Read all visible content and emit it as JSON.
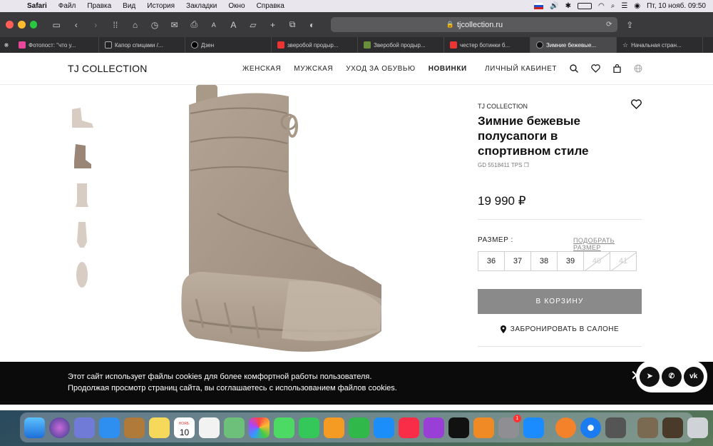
{
  "menubar": {
    "app": "Safari",
    "items": [
      "Файл",
      "Правка",
      "Вид",
      "История",
      "Закладки",
      "Окно",
      "Справка"
    ],
    "datetime": "Пт, 10 нояб.  09:50"
  },
  "browser": {
    "url": "tjcollection.ru",
    "tabs": [
      {
        "label": "Фотопост: \"что у...",
        "active": false
      },
      {
        "label": "Капор спицами /...",
        "active": false
      },
      {
        "label": "Дзен",
        "active": false
      },
      {
        "label": "зверобой продыр...",
        "active": false
      },
      {
        "label": "Зверобой продыр...",
        "active": false
      },
      {
        "label": "честер ботинки б...",
        "active": false
      },
      {
        "label": "Зимние бежевые...",
        "active": true
      },
      {
        "label": "Начальная стран...",
        "active": false
      }
    ]
  },
  "site": {
    "logo": "TJ COLLECTION",
    "nav": [
      "ЖЕНСКАЯ",
      "МУЖСКАЯ",
      "УХОД ЗА ОБУВЬЮ",
      "НОВИНКИ"
    ],
    "account": "ЛИЧНЫЙ КАБИНЕТ"
  },
  "product": {
    "brand": "TJ COLLECTION",
    "title": "Зимние бежевые полусапоги в спортивном стиле",
    "sku": "GD 5518411 TPS",
    "price": "19 990 ₽",
    "size_label": "РАЗМЕР :",
    "size_guide": "ПОДОБРАТЬ РАЗМЕР",
    "sizes": [
      {
        "value": "36",
        "available": true
      },
      {
        "value": "37",
        "available": true
      },
      {
        "value": "38",
        "available": true
      },
      {
        "value": "39",
        "available": true
      },
      {
        "value": "40",
        "available": false
      },
      {
        "value": "41",
        "available": false
      }
    ],
    "cart_button": "В КОРЗИНУ",
    "reserve": "ЗАБРОНИРОВАТЬ В САЛОНЕ"
  },
  "cookie": {
    "line1": "Этот сайт использует файлы cookies для более комфортной работы пользователя.",
    "line2": "Продолжая просмотр страниц сайта, вы соглашаетесь с использованием файлов cookies."
  },
  "social": [
    "telegram",
    "whatsapp",
    "vk"
  ],
  "dock": {
    "calendar_month": "НОЯБ.",
    "calendar_day": "10",
    "badge": "1"
  }
}
